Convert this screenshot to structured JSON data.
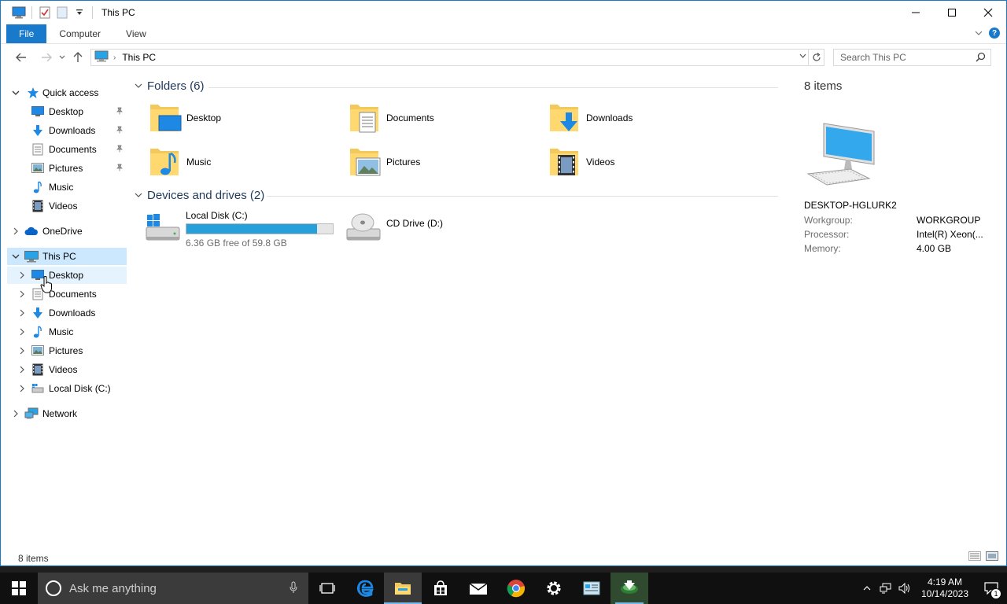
{
  "window": {
    "title": "This PC",
    "accent": "#1979ca"
  },
  "ribbon": {
    "tabs": [
      "File",
      "Computer",
      "View"
    ]
  },
  "address": {
    "crumb": "This PC"
  },
  "search": {
    "placeholder": "Search This PC"
  },
  "navpane": {
    "quick_access": "Quick access",
    "quick_items": [
      "Desktop",
      "Downloads",
      "Documents",
      "Pictures",
      "Music",
      "Videos"
    ],
    "onedrive": "OneDrive",
    "this_pc": "This PC",
    "pc_items": [
      "Desktop",
      "Documents",
      "Downloads",
      "Music",
      "Pictures",
      "Videos",
      "Local Disk (C:)"
    ],
    "network": "Network"
  },
  "content": {
    "folders_header": "Folders (6)",
    "folders": [
      "Desktop",
      "Documents",
      "Downloads",
      "Music",
      "Pictures",
      "Videos"
    ],
    "drives_header": "Devices and drives (2)",
    "drives": [
      {
        "name": "Local Disk (C:)",
        "free": "6.36 GB free of 59.8 GB",
        "used_fraction": 0.894
      },
      {
        "name": "CD Drive (D:)"
      }
    ]
  },
  "details": {
    "count": "8 items",
    "pc_name": "DESKTOP-HGLURK2",
    "props": [
      {
        "label": "Workgroup:",
        "value": "WORKGROUP"
      },
      {
        "label": "Processor:",
        "value": "Intel(R) Xeon(..."
      },
      {
        "label": "Memory:",
        "value": "4.00 GB"
      }
    ]
  },
  "status": {
    "items": "8 items"
  },
  "taskbar": {
    "search_placeholder": "Ask me anything",
    "time": "4:19 AM",
    "date": "10/14/2023",
    "notifications": "1"
  }
}
